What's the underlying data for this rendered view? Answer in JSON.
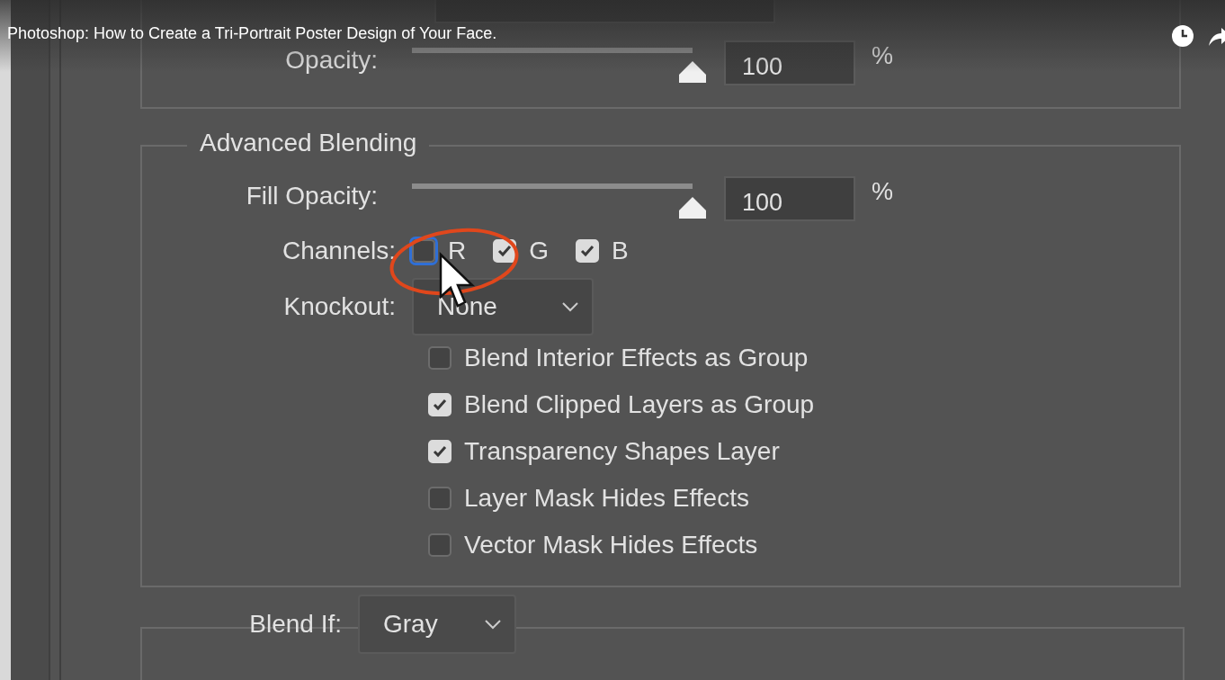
{
  "video_title": "Photoshop: How to Create a Tri-Portrait Poster Design of Your Face.",
  "opacity": {
    "label": "Opacity:",
    "level": 1,
    "value": "100",
    "unit": "%"
  },
  "advanced_blending": {
    "title": "Advanced Blending",
    "fill_opacity": {
      "label": "Fill Opacity:",
      "level": 1,
      "value": "100",
      "unit": "%"
    },
    "channels": {
      "label": "Channels:",
      "items": [
        {
          "label": "R",
          "checked": false,
          "focused": true
        },
        {
          "label": "G",
          "checked": true
        },
        {
          "label": "B",
          "checked": true
        }
      ]
    },
    "knockout": {
      "label": "Knockout:",
      "value": "None"
    },
    "options": [
      {
        "label": "Blend Interior Effects as Group",
        "checked": false
      },
      {
        "label": "Blend Clipped Layers as Group",
        "checked": true
      },
      {
        "label": "Transparency Shapes Layer",
        "checked": true
      },
      {
        "label": "Layer Mask Hides Effects",
        "checked": false
      },
      {
        "label": "Vector Mask Hides Effects",
        "checked": false
      }
    ]
  },
  "blend_if": {
    "label": "Blend If:",
    "value": "Gray"
  }
}
